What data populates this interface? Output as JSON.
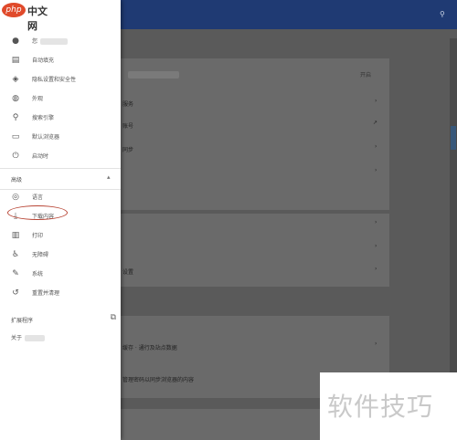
{
  "logo": {
    "php": "php",
    "text": "中文网"
  },
  "nav": {
    "items": [
      {
        "label": "您",
        "icon": "person-icon",
        "glyph": "●",
        "name": "nav-you"
      },
      {
        "label": "自动填充",
        "icon": "clipboard-icon",
        "glyph": "▤",
        "name": "nav-autofill"
      },
      {
        "label": "隐私设置和安全性",
        "icon": "shield-icon",
        "glyph": "◈",
        "name": "nav-privacy"
      },
      {
        "label": "外观",
        "icon": "palette-icon",
        "glyph": "◍",
        "name": "nav-appearance"
      },
      {
        "label": "搜索引擎",
        "icon": "search-icon",
        "glyph": "⚲",
        "name": "nav-search-engine"
      },
      {
        "label": "默认浏览器",
        "icon": "browser-icon",
        "glyph": "▭",
        "name": "nav-default-browser"
      },
      {
        "label": "启动时",
        "icon": "power-icon",
        "glyph": "⏻",
        "name": "nav-on-startup"
      }
    ],
    "advanced_label": "高级",
    "advanced_items": [
      {
        "label": "语言",
        "icon": "globe-icon",
        "glyph": "◎",
        "name": "nav-languages"
      },
      {
        "label": "下载内容",
        "icon": "download-icon",
        "glyph": "⤓",
        "name": "nav-downloads"
      },
      {
        "label": "打印",
        "icon": "print-icon",
        "glyph": "▥",
        "name": "nav-print"
      },
      {
        "label": "无障碍",
        "icon": "accessibility-icon",
        "glyph": "♿",
        "name": "nav-accessibility"
      },
      {
        "label": "系统",
        "icon": "wrench-icon",
        "glyph": "✎",
        "name": "nav-system"
      },
      {
        "label": "重置并清理",
        "icon": "history-icon",
        "glyph": "↺",
        "name": "nav-reset"
      }
    ],
    "extensions_label": "扩展程序",
    "about_label": "关于"
  },
  "main": {
    "card1": {
      "action": "开启",
      "rows": [
        "服务",
        "账号",
        "同步"
      ]
    },
    "card3": {
      "rows": [
        "缓存 · 通行及站点数据",
        "管理密码以同步浏览器的内容"
      ]
    },
    "card2": {
      "rows": [
        "设置"
      ]
    }
  },
  "watermark": "软件技巧"
}
